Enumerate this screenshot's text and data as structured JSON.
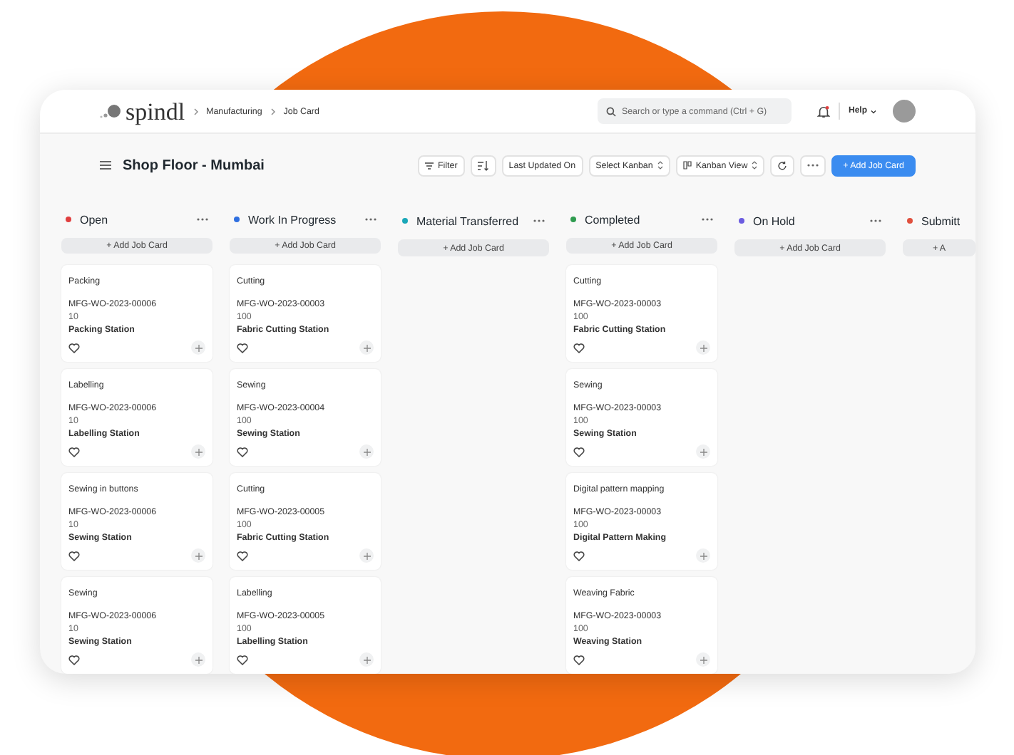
{
  "navbar": {
    "logo": "spindl",
    "breadcrumbs": [
      "Manufacturing",
      "Job Card"
    ],
    "search": {
      "placeholder": "Search or type a command (Ctrl + G)"
    },
    "help": "Help"
  },
  "page": {
    "title": "Shop Floor - Mumbai"
  },
  "toolbar": [
    {
      "kind": "filter",
      "label": "Filter"
    },
    {
      "kind": "sort"
    },
    {
      "kind": "plain",
      "label": "Last Updated On"
    },
    {
      "kind": "select",
      "label": "Select Kanban"
    },
    {
      "kind": "view",
      "label": "Kanban View"
    },
    {
      "kind": "refresh"
    },
    {
      "kind": "more"
    },
    {
      "kind": "primary",
      "label": "+ Add Job Card"
    }
  ],
  "columns": [
    {
      "title": "Open",
      "color": "#e03e3e",
      "add_label": "+ Add Job Card",
      "cards": [
        {
          "operation": "Packing",
          "work_order": "MFG-WO-2023-00006",
          "quantity": "10",
          "workstation": "Packing Station"
        },
        {
          "operation": "Labelling",
          "work_order": "MFG-WO-2023-00006",
          "quantity": "10",
          "workstation": "Labelling Station"
        },
        {
          "operation": "Sewing in buttons",
          "work_order": "MFG-WO-2023-00006",
          "quantity": "10",
          "workstation": "Sewing Station"
        },
        {
          "operation": "Sewing",
          "work_order": "MFG-WO-2023-00006",
          "quantity": "10",
          "workstation": "Sewing Station"
        }
      ]
    },
    {
      "title": "Work In Progress",
      "color": "#2f6fe0",
      "add_label": "+ Add Job Card",
      "cards": [
        {
          "operation": "Cutting",
          "work_order": "MFG-WO-2023-00003",
          "quantity": "100",
          "workstation": "Fabric Cutting Station"
        },
        {
          "operation": "Sewing",
          "work_order": "MFG-WO-2023-00004",
          "quantity": "100",
          "workstation": "Sewing Station"
        },
        {
          "operation": "Cutting",
          "work_order": "MFG-WO-2023-00005",
          "quantity": "100",
          "workstation": "Fabric Cutting Station"
        },
        {
          "operation": "Labelling",
          "work_order": "MFG-WO-2023-00005",
          "quantity": "100",
          "workstation": "Labelling Station"
        }
      ]
    },
    {
      "title": "Material Transferred",
      "color": "#1aa7b8",
      "add_label": "+ Add Job Card"
    },
    {
      "title": "Completed",
      "color": "#2e9b4f",
      "add_label": "+ Add Job Card",
      "cards": [
        {
          "operation": "Cutting",
          "work_order": "MFG-WO-2023-00003",
          "quantity": "100",
          "workstation": "Fabric Cutting Station"
        },
        {
          "operation": "Sewing",
          "work_order": "MFG-WO-2023-00003",
          "quantity": "100",
          "workstation": "Sewing Station"
        },
        {
          "operation": "Digital pattern mapping",
          "work_order": "MFG-WO-2023-00003",
          "quantity": "100",
          "workstation": "Digital Pattern Making"
        },
        {
          "operation": "Weaving Fabric",
          "work_order": "MFG-WO-2023-00003",
          "quantity": "100",
          "workstation": "Weaving Station"
        }
      ]
    },
    {
      "title": "On Hold",
      "color": "#6b5ce0",
      "add_label": "+ Add Job Card"
    },
    {
      "title": "Submitt",
      "color": "#e0503e",
      "add_label": "+ A"
    }
  ]
}
